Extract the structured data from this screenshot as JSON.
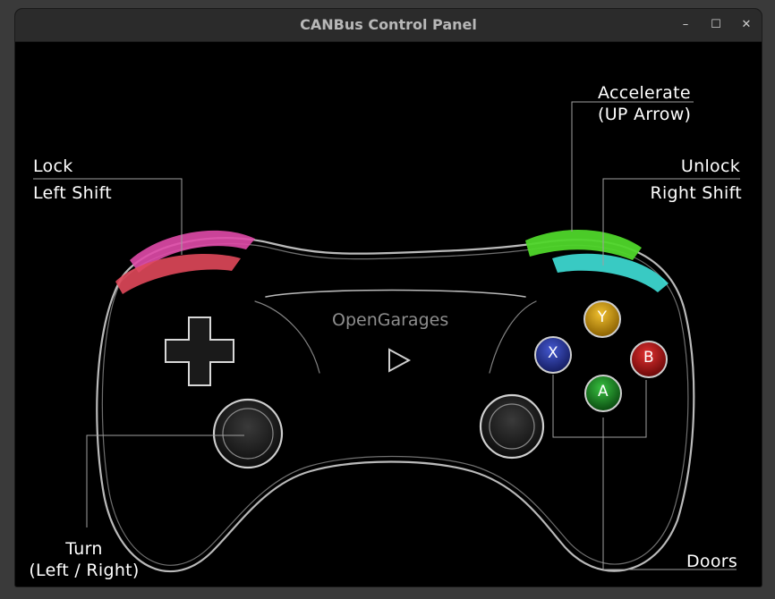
{
  "window": {
    "title": "CANBus Control Panel"
  },
  "controls": {
    "minimize": "–",
    "maximize": "☐",
    "close": "✕"
  },
  "brand": "OpenGarages",
  "labels": {
    "lock": "Lock",
    "lock_key": "Left Shift",
    "accelerate": "Accelerate",
    "accelerate_key": "(UP Arrow)",
    "unlock": "Unlock",
    "unlock_key": "Right Shift",
    "turn": "Turn",
    "turn_key": "(Left / Right)",
    "doors": "Doors"
  },
  "face_buttons": {
    "y": "Y",
    "x": "X",
    "b": "B",
    "a": "A"
  },
  "colors": {
    "lock_bumper": "#e04aa8",
    "left_trigger": "#e0485a",
    "accelerate_bumper": "#4fd62a",
    "unlock_trigger": "#3fe0d8",
    "btn_y": "#d4a010",
    "btn_x": "#2a3aa8",
    "btn_b": "#c01818",
    "btn_a": "#1f9a2a"
  }
}
